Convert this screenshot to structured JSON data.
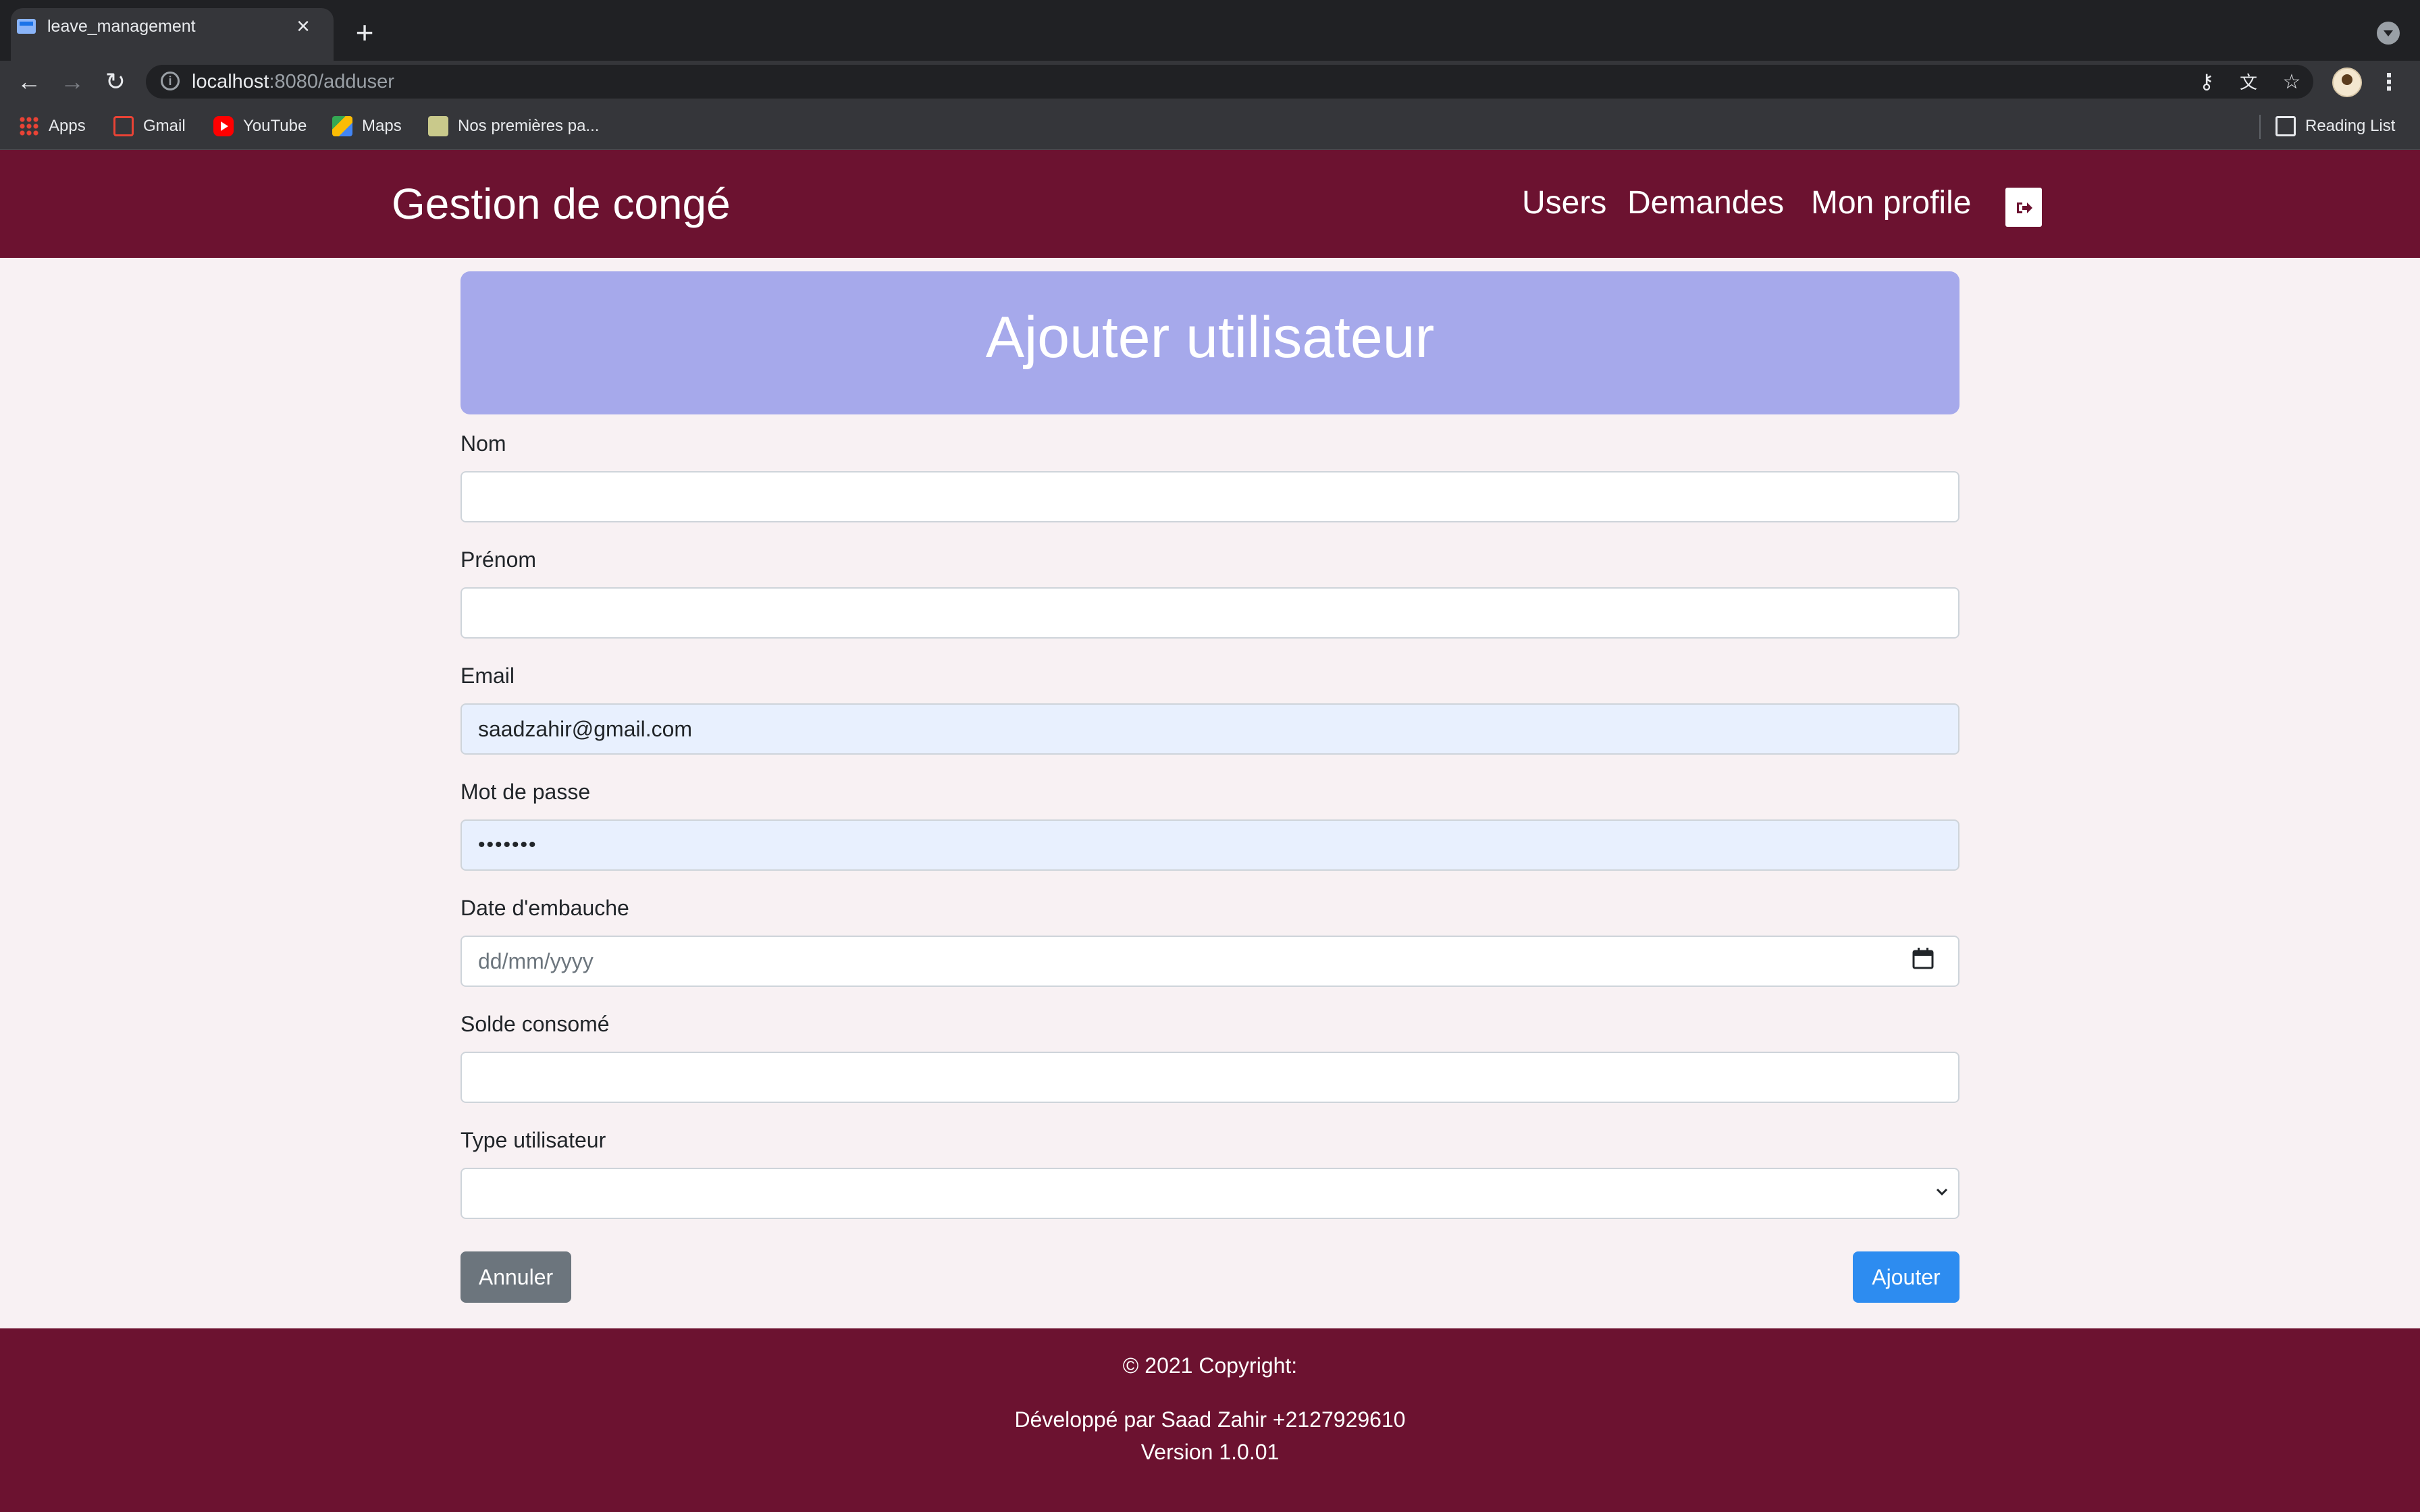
{
  "browser": {
    "tab_title": "leave_management",
    "url_host": "localhost",
    "url_path": ":8080/adduser",
    "bookmarks": [
      "Apps",
      "Gmail",
      "YouTube",
      "Maps",
      "Nos premières pa..."
    ],
    "reading_list": "Reading List"
  },
  "navbar": {
    "brand": "Gestion de congé",
    "links": [
      "Users",
      "Demandes",
      "Mon profile"
    ],
    "logout_icon": "sign-out-icon"
  },
  "form": {
    "title": "Ajouter utilisateur",
    "nom_label": "Nom",
    "nom_value": "",
    "prenom_label": "Prénom",
    "prenom_value": "",
    "email_label": "Email",
    "email_value": "saadzahir@gmail.com",
    "password_label": "Mot de passe",
    "password_value": "•••••••",
    "date_label": "Date d'embauche",
    "date_placeholder": "dd/mm/yyyy",
    "solde_label": "Solde consomé",
    "solde_value": "",
    "type_label": "Type utilisateur",
    "type_value": "",
    "cancel_label": "Annuler",
    "submit_label": "Ajouter"
  },
  "footer": {
    "copyright": "© 2021 Copyright:",
    "developer": "Développé par Saad Zahir +2127929610",
    "version": "Version 1.0.01"
  },
  "colors": {
    "brand": "#6c1230",
    "header_card": "#a6a9eb",
    "primary_button": "#2d8cf0",
    "secondary_button": "#6c757d",
    "page_background": "#f8f1f3"
  }
}
